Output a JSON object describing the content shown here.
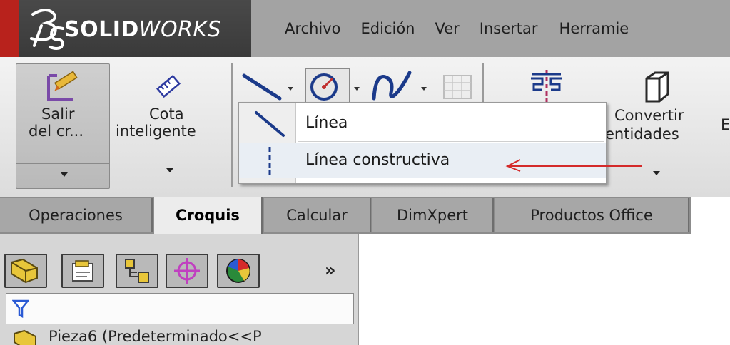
{
  "app": {
    "brand_bold": "SOLID",
    "brand_italic": "WORKS"
  },
  "menu": {
    "items": [
      "Archivo",
      "Edición",
      "Ver",
      "Insertar",
      "Herramie"
    ]
  },
  "ribbon": {
    "exit_sketch_line1": "Salir",
    "exit_sketch_line2": "del cr...",
    "smart_dimension_line1": "Cota",
    "smart_dimension_line2": "inteligente",
    "convert_line1": "Convertir",
    "convert_line2": "entidades",
    "overflow_char": "E"
  },
  "dropdown": {
    "items": [
      {
        "label": "Línea"
      },
      {
        "label": "Línea constructiva"
      }
    ]
  },
  "tabs": [
    {
      "label": "Operaciones",
      "active": false
    },
    {
      "label": "Croquis",
      "active": true
    },
    {
      "label": "Calcular",
      "active": false
    },
    {
      "label": "DimXpert",
      "active": false
    },
    {
      "label": "Productos Office",
      "active": false
    }
  ],
  "panel": {
    "overflow_label": "»",
    "tree_text": "Pieza6 (Predeterminado<<P"
  },
  "colors": {
    "brand_red": "#b8221c",
    "annotation_arrow": "#d42a2a",
    "active_tab": "#ececec"
  }
}
